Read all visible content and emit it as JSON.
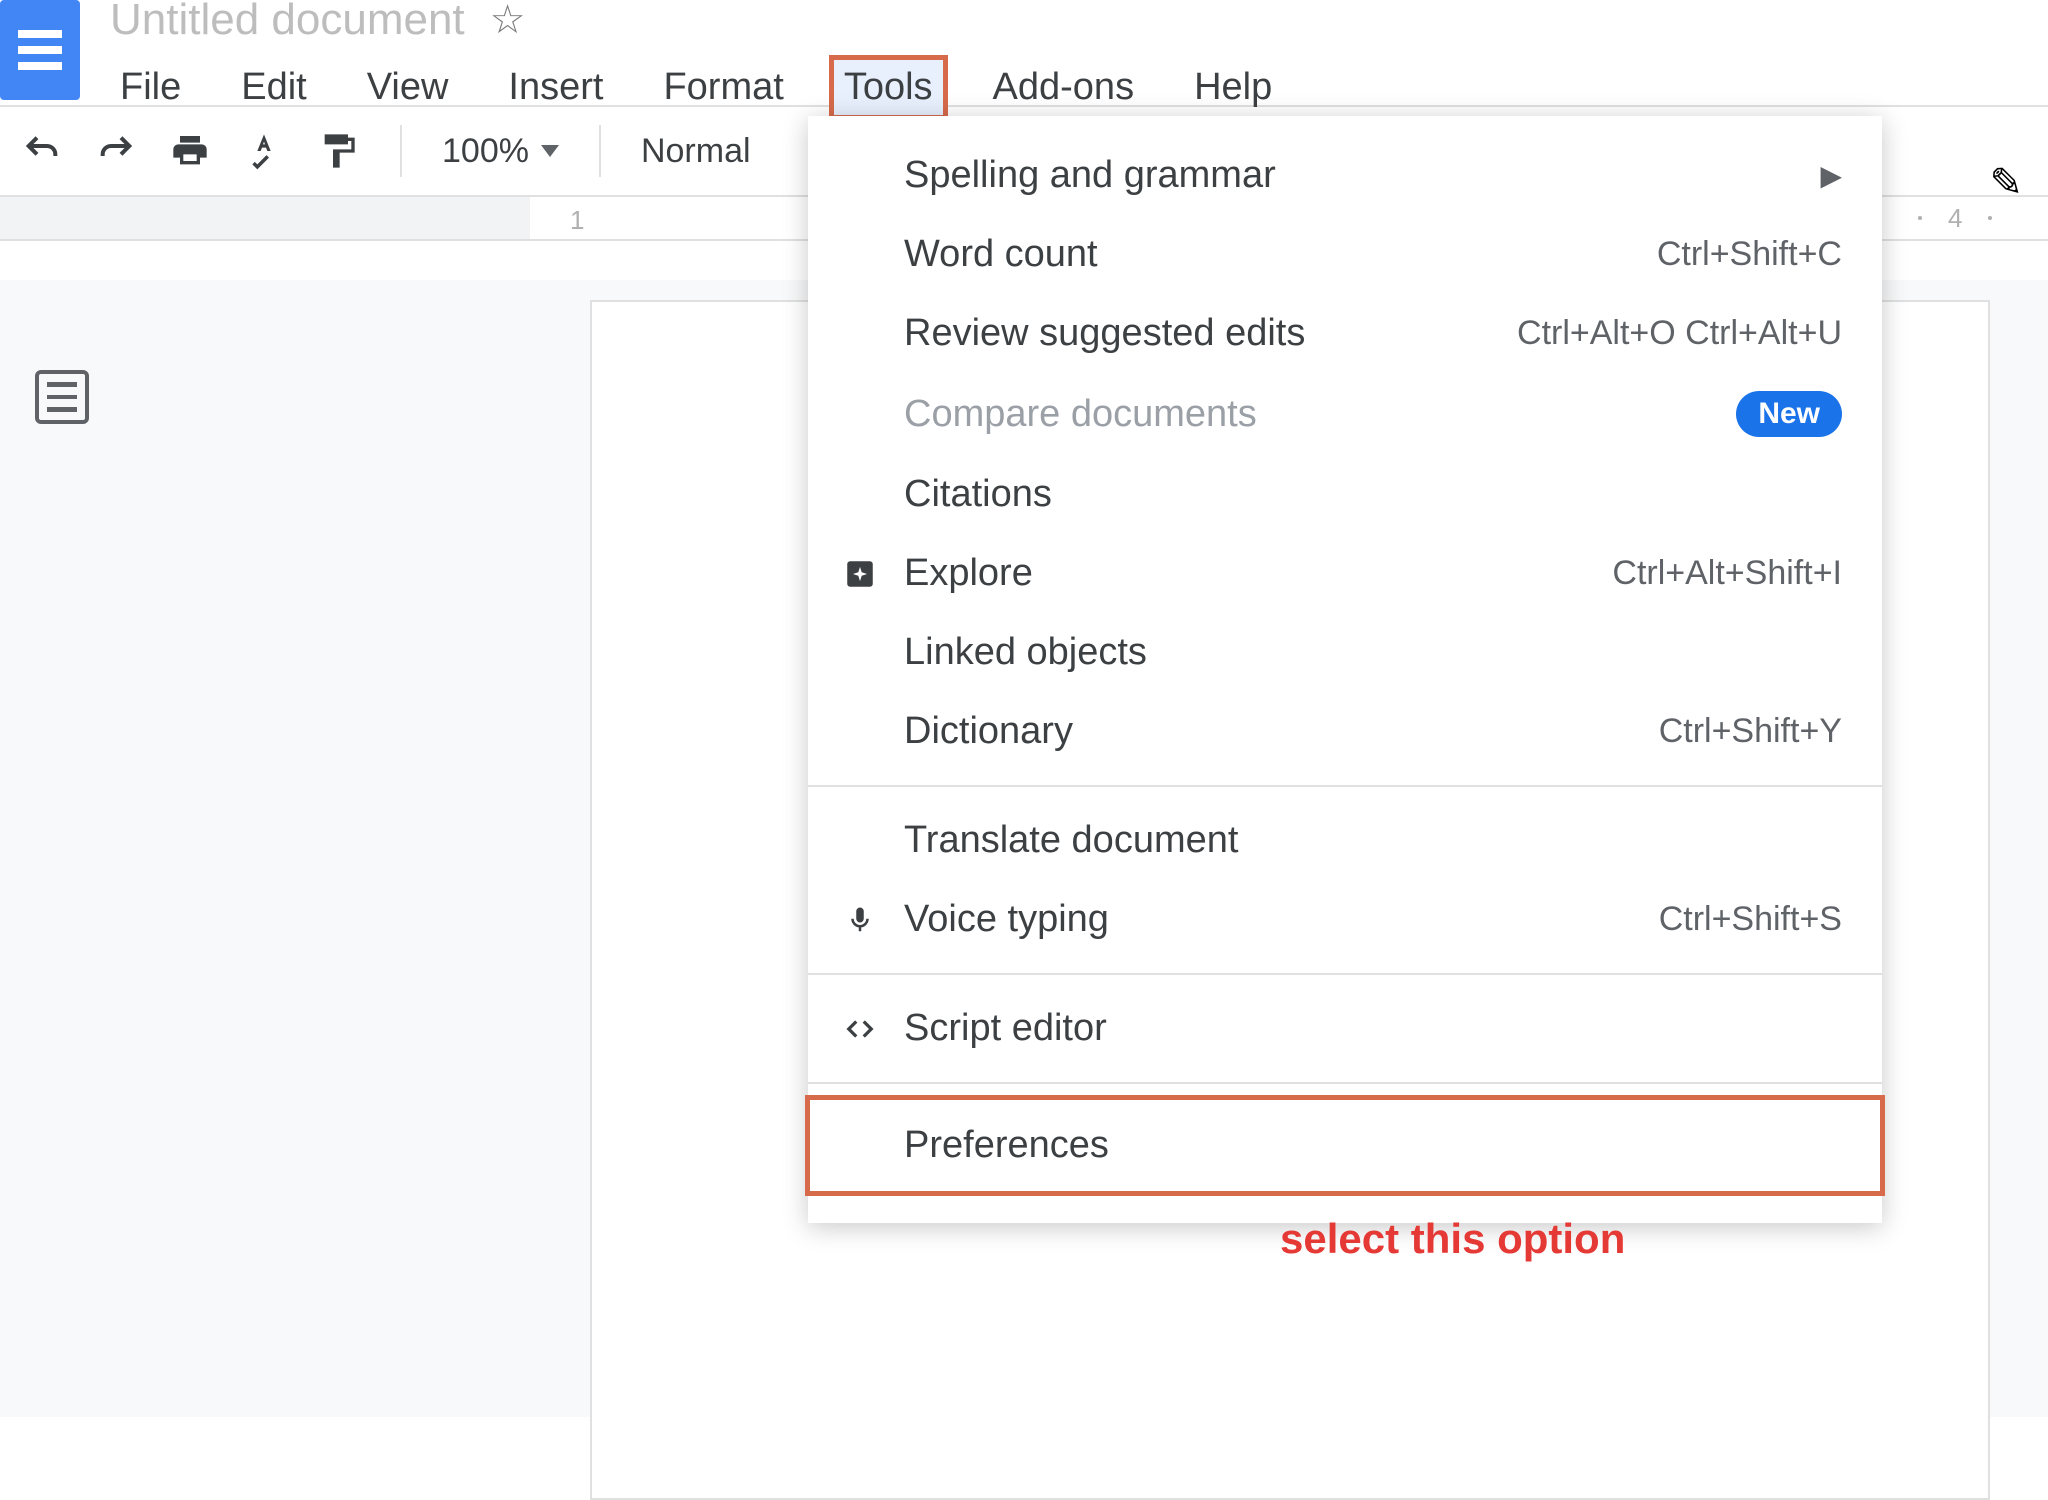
{
  "app": {
    "title": "Untitled document"
  },
  "menubar": {
    "items": [
      "File",
      "Edit",
      "View",
      "Insert",
      "Format",
      "Tools",
      "Add-ons",
      "Help"
    ],
    "active_index": 5
  },
  "toolbar": {
    "zoom_label": "100%",
    "style_label": "Normal"
  },
  "ruler": {
    "num_left": "1",
    "num_right": "4"
  },
  "dropdown": {
    "items": [
      {
        "label": "Spelling and grammar",
        "shortcut": "",
        "icon": "",
        "submenu": true
      },
      {
        "label": "Word count",
        "shortcut": "Ctrl+Shift+C",
        "icon": ""
      },
      {
        "label": "Review suggested edits",
        "shortcut": "Ctrl+Alt+O Ctrl+Alt+U",
        "icon": ""
      },
      {
        "label": "Compare documents",
        "shortcut": "",
        "icon": "",
        "disabled": true,
        "badge": "New"
      },
      {
        "label": "Citations",
        "shortcut": "",
        "icon": ""
      },
      {
        "label": "Explore",
        "shortcut": "Ctrl+Alt+Shift+I",
        "icon": "explore"
      },
      {
        "label": "Linked objects",
        "shortcut": "",
        "icon": ""
      },
      {
        "label": "Dictionary",
        "shortcut": "Ctrl+Shift+Y",
        "icon": ""
      },
      {
        "sep": true
      },
      {
        "label": "Translate document",
        "shortcut": "",
        "icon": ""
      },
      {
        "label": "Voice typing",
        "shortcut": "Ctrl+Shift+S",
        "icon": "mic"
      },
      {
        "sep": true
      },
      {
        "label": "Script editor",
        "shortcut": "",
        "icon": "code"
      },
      {
        "sep": true
      },
      {
        "label": "Preferences",
        "shortcut": "",
        "icon": "",
        "highlight": true
      }
    ]
  },
  "annotation_text": "select this option"
}
